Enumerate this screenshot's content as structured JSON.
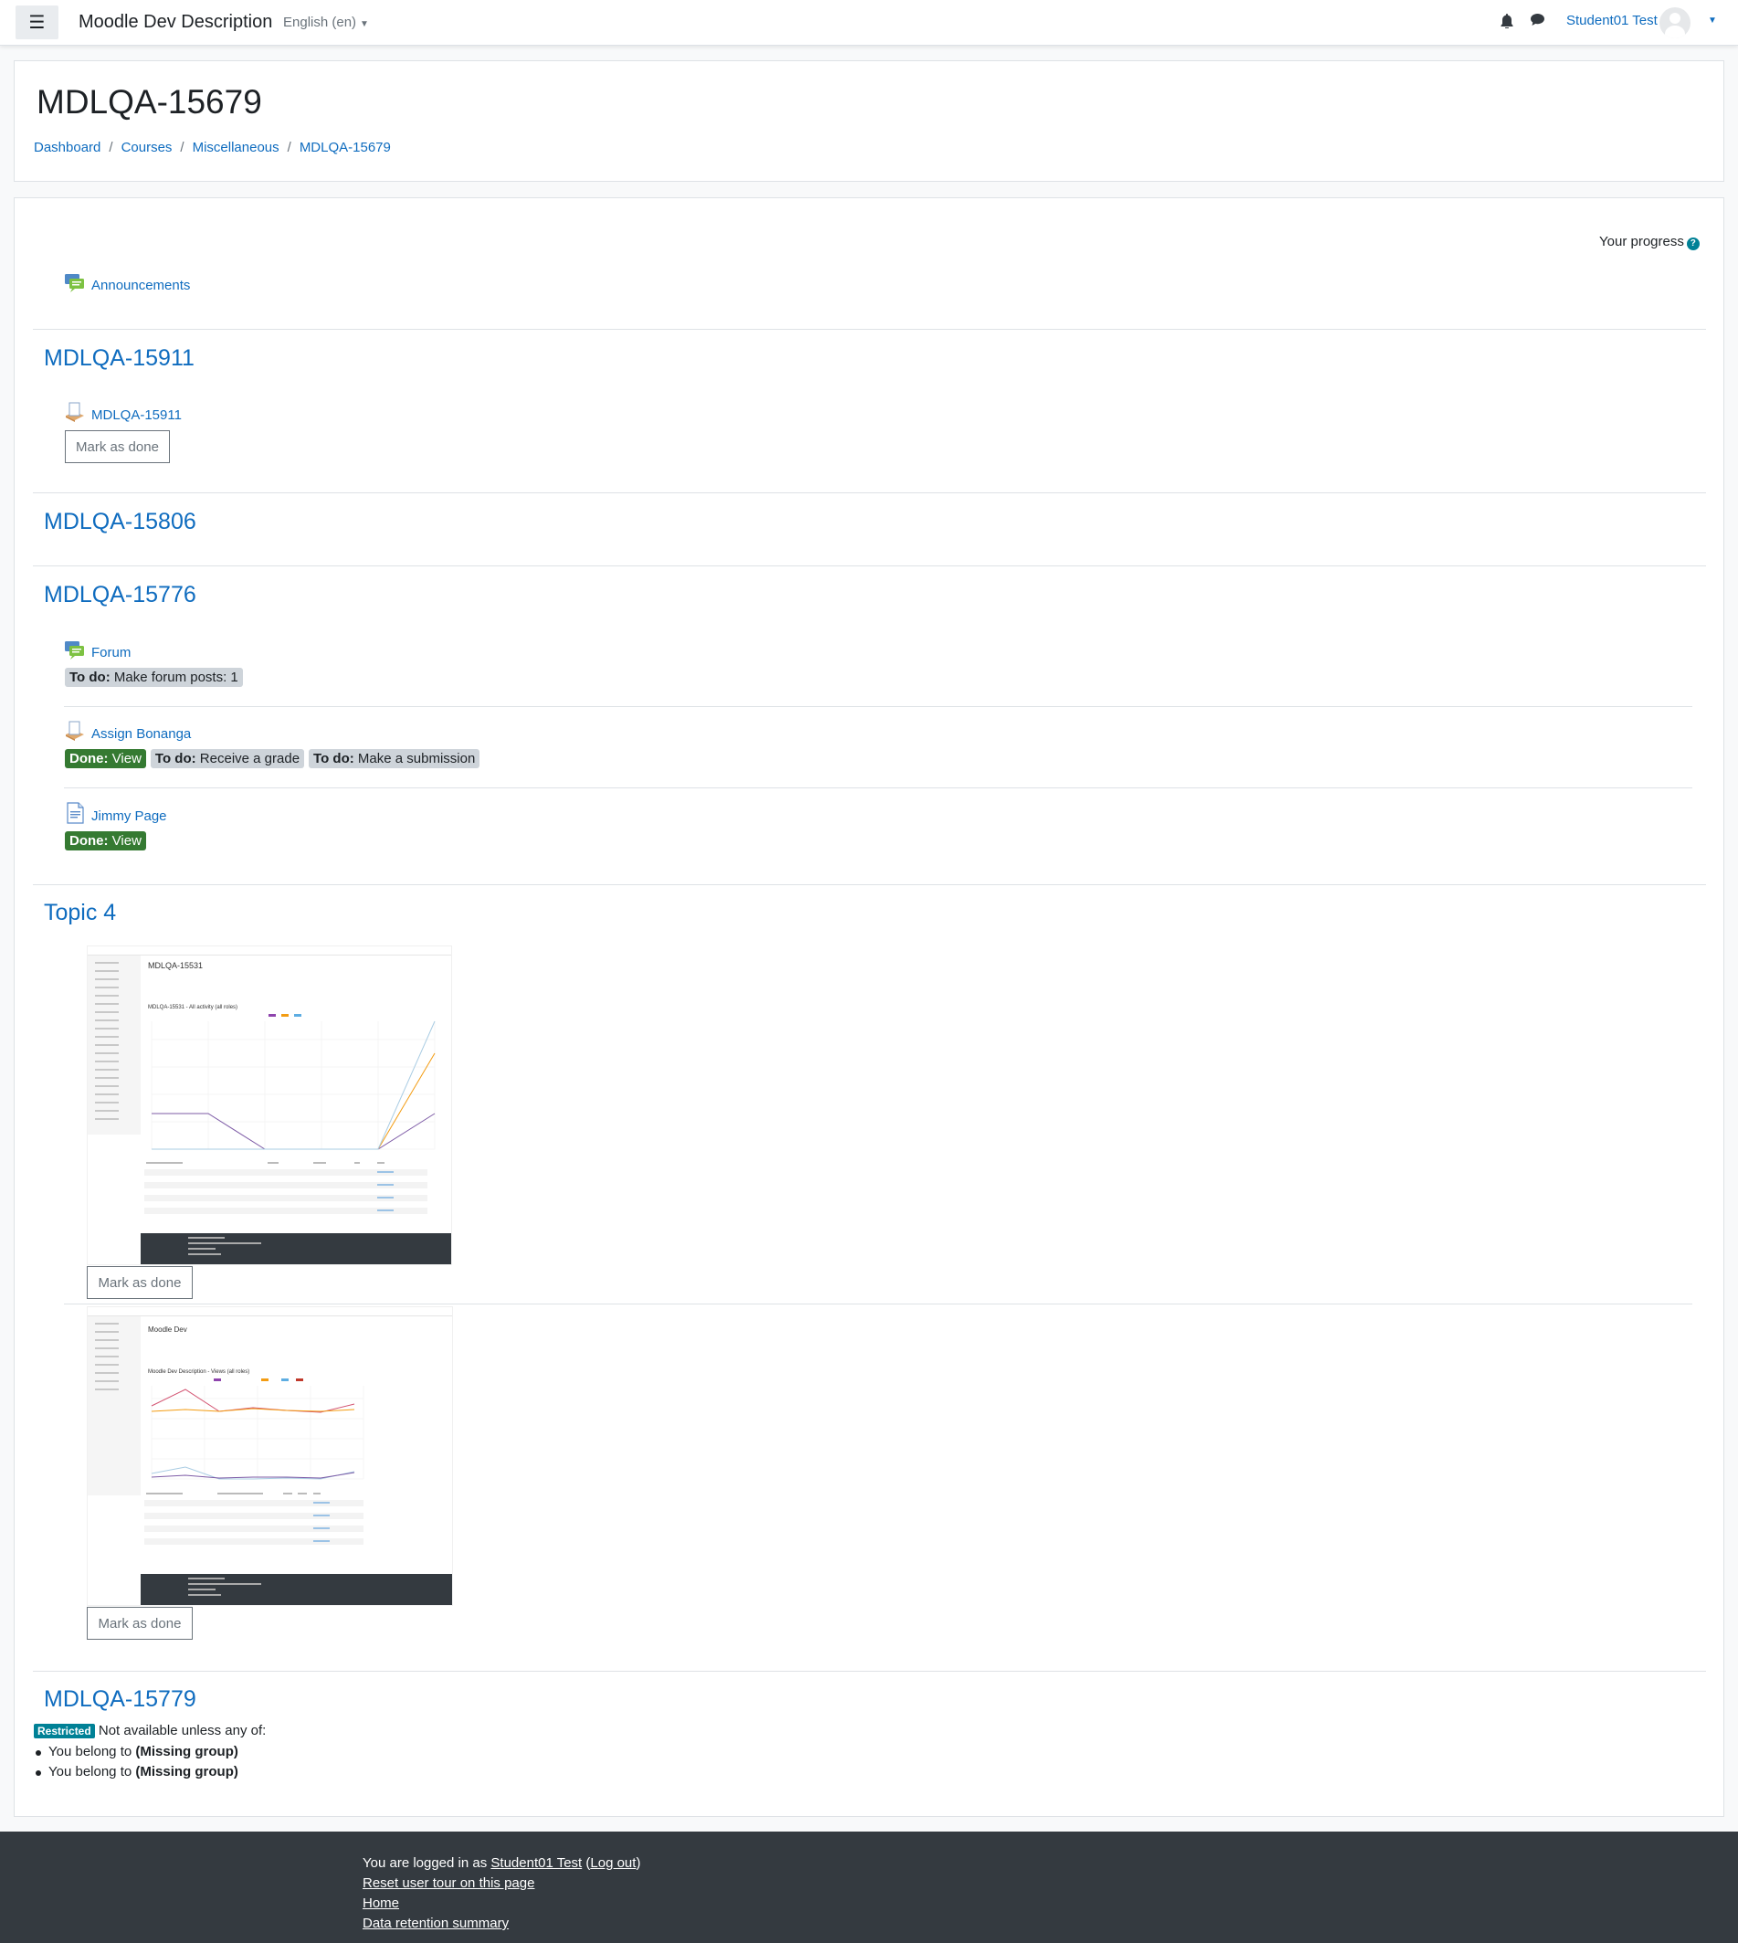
{
  "navbar": {
    "site_name": "Moodle Dev Description",
    "language": "English ‎(en)‎",
    "user_name": "Student01 Test"
  },
  "header": {
    "title": "MDLQA-15679",
    "breadcrumb": [
      "Dashboard",
      "Courses",
      "Miscellaneous",
      "MDLQA-15679"
    ]
  },
  "course": {
    "progress_label": "Your progress",
    "announcements": "Announcements",
    "sections": [
      {
        "title": "MDLQA-15911",
        "activity": "MDLQA-15911",
        "mark_done": "Mark as done"
      },
      {
        "title": "MDLQA-15806"
      },
      {
        "title": "MDLQA-15776",
        "activities": [
          {
            "name": "Forum",
            "badges": [
              {
                "type": "todo",
                "prefix": "To do:",
                "text": "Make forum posts: 1"
              }
            ]
          },
          {
            "name": "Assign Bonanga",
            "badges": [
              {
                "type": "done",
                "prefix": "Done:",
                "text": "View"
              },
              {
                "type": "todo",
                "prefix": "To do:",
                "text": "Receive a grade"
              },
              {
                "type": "todo",
                "prefix": "To do:",
                "text": "Make a submission"
              }
            ]
          },
          {
            "name": "Jimmy Page",
            "badges": [
              {
                "type": "done",
                "prefix": "Done:",
                "text": "View"
              }
            ]
          }
        ]
      },
      {
        "title": "Topic 4",
        "labels": [
          {
            "mark_done": "Mark as done",
            "shot_title": "MDLQA-15531",
            "shot_subtitle": "MDLQA-15531 - All activity (all roles)"
          },
          {
            "mark_done": "Mark as done",
            "shot_title": "Moodle Dev",
            "shot_subtitle": "Moodle Dev Description - Views (all roles)"
          }
        ]
      },
      {
        "title": "MDLQA-15779",
        "restricted_label": "Restricted",
        "restriction_text": "Not available unless any of:",
        "conditions": [
          {
            "prefix": "You belong to",
            "group": "(Missing group)"
          },
          {
            "prefix": "You belong to",
            "group": "(Missing group)"
          }
        ]
      }
    ]
  },
  "footer": {
    "logged_in_prefix": "You are logged in as",
    "user_link": "Student01 Test",
    "logout": "Log out",
    "reset_tour": "Reset user tour on this page",
    "home": "Home",
    "data_retention": "Data retention summary"
  },
  "colors": {
    "link": "#0f6cbf",
    "done_badge": "#357a32",
    "todo_badge": "#ced4da",
    "restricted_badge": "#008196",
    "footer_bg": "#343a40"
  }
}
